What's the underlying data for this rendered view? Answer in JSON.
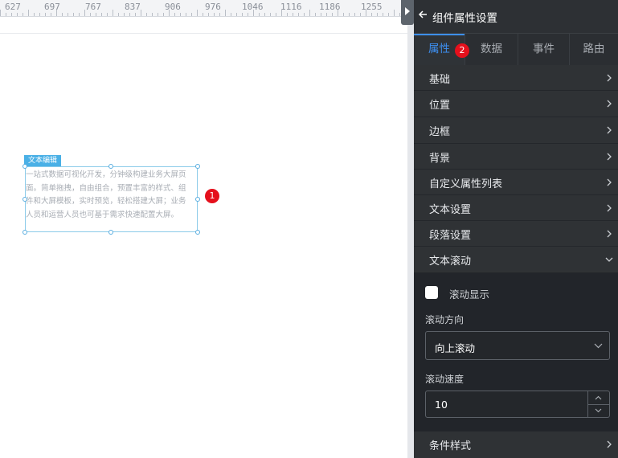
{
  "ruler": {
    "ticks": [
      "627",
      "697",
      "767",
      "837",
      "906",
      "976",
      "1046",
      "1116",
      "1186",
      "1255"
    ]
  },
  "component": {
    "tag": "文本编辑",
    "text_lines": [
      "一站式数据可视化开发，分钟级构建业务大屏页",
      "面。简单拖拽，自由组合，预置丰富的样式、组",
      "件和大屏模板，实时预览，轻松搭建大屏；业务",
      "人员和运营人员也可基于需求快速配置大屏。"
    ],
    "badge": "1"
  },
  "panel": {
    "title": "组件属性设置",
    "tabs": [
      {
        "label": "属性",
        "active": true
      },
      {
        "label": "数据",
        "active": false
      },
      {
        "label": "事件",
        "active": false
      },
      {
        "label": "路由",
        "active": false
      }
    ],
    "tab_badge": "2",
    "sections": [
      "基础",
      "位置",
      "边框",
      "背景",
      "自定义属性列表",
      "文本设置",
      "段落设置",
      "文本滚动"
    ],
    "scroll": {
      "show_label": "滚动显示",
      "show_checked": false,
      "direction_label": "滚动方向",
      "direction_value": "向上滚动",
      "speed_label": "滚动速度",
      "speed_value": "10"
    },
    "footer_section": "条件样式"
  },
  "colors": {
    "accent": "#3d8ff0",
    "badge": "#e5101c",
    "panel_bg": "#24272b"
  }
}
